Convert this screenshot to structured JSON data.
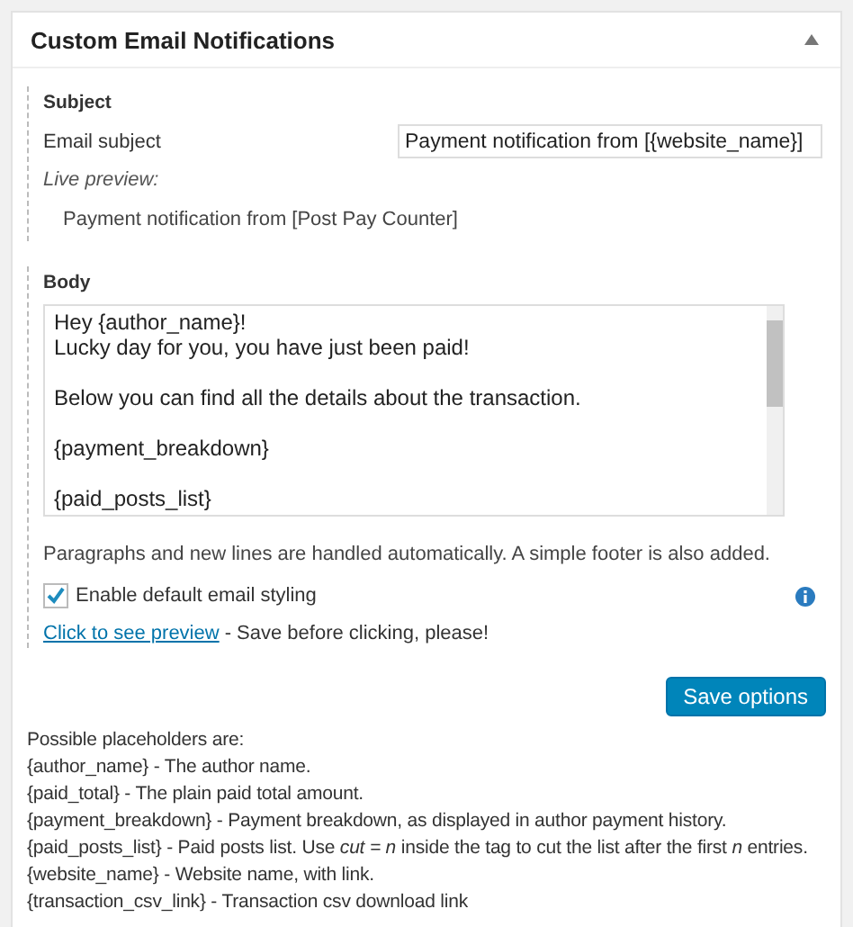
{
  "panel": {
    "title": "Custom Email Notifications",
    "expanded": true
  },
  "subject": {
    "heading": "Subject",
    "label": "Email subject",
    "value": "Payment notification from [{website_name}]",
    "preview_label": "Live preview:",
    "preview": "Payment notification from [Post Pay Counter]"
  },
  "body": {
    "heading": "Body",
    "paragraphs": [
      [
        "Hey {author_name}!",
        "Lucky day for you, you have just been paid!"
      ],
      [
        "Below you can find all the details about the transaction."
      ],
      [
        "{payment_breakdown}"
      ],
      [
        "{paid_posts_list}"
      ]
    ],
    "note": "Paragraphs and new lines are handled automatically. A simple footer is also added.",
    "styling": {
      "label": "Enable default email styling",
      "checked": true
    },
    "preview_link": "Click to see preview",
    "preview_note": "- Save before clicking, please!"
  },
  "save_button": "Save options",
  "placeholders": [
    "Possible placeholders are:",
    "{author_name} - The author name.",
    "{paid_total} - The plain paid total amount.",
    "{payment_breakdown} - Payment breakdown, as displayed in author payment history.",
    "{paid_posts_list} - Paid posts list. Use *cut = n* inside the tag to cut the list after the first *n* entries.",
    "{website_name} - Website name, with link.",
    "{transaction_csv_link} - Transaction csv download link"
  ]
}
